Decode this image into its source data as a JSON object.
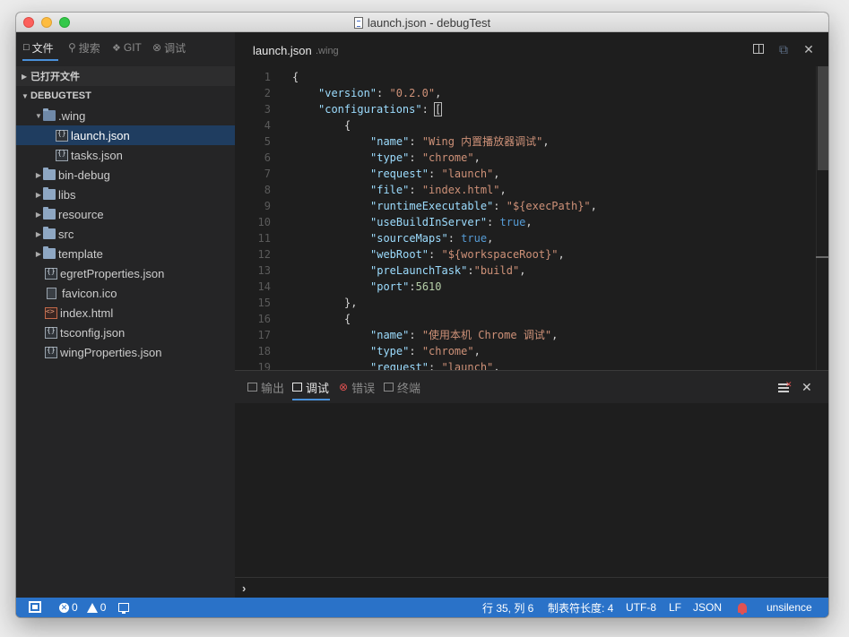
{
  "window": {
    "title": "launch.json - debugTest"
  },
  "sidebar": {
    "tabs": [
      {
        "label": "文件",
        "icon": "files-icon",
        "active": true
      },
      {
        "label": "搜索",
        "icon": "search-icon",
        "active": false
      },
      {
        "label": "GIT",
        "icon": "git-icon",
        "active": false
      },
      {
        "label": "调试",
        "icon": "debug-icon",
        "active": false
      }
    ],
    "sections": {
      "open_editors": "已打开文件",
      "project": "DEBUGTEST"
    },
    "tree": [
      {
        "label": ".wing",
        "type": "folder",
        "expanded": true,
        "depth": 1
      },
      {
        "label": "launch.json",
        "type": "json",
        "depth": 2,
        "selected": true
      },
      {
        "label": "tasks.json",
        "type": "json",
        "depth": 2
      },
      {
        "label": "bin-debug",
        "type": "folder",
        "depth": 1
      },
      {
        "label": "libs",
        "type": "folder",
        "depth": 1
      },
      {
        "label": "resource",
        "type": "folder",
        "depth": 1
      },
      {
        "label": "src",
        "type": "folder",
        "depth": 1
      },
      {
        "label": "template",
        "type": "folder",
        "depth": 1
      },
      {
        "label": "egretProperties.json",
        "type": "json",
        "depth": 1
      },
      {
        "label": "favicon.ico",
        "type": "ico",
        "depth": 1
      },
      {
        "label": "index.html",
        "type": "html",
        "depth": 1
      },
      {
        "label": "tsconfig.json",
        "type": "json",
        "depth": 1
      },
      {
        "label": "wingProperties.json",
        "type": "json",
        "depth": 1
      }
    ]
  },
  "editor": {
    "tab": {
      "file": "launch.json",
      "dir": ".wing"
    },
    "lines": [
      {
        "n": "1",
        "indent": 0,
        "parts": [
          {
            "t": "{",
            "c": "p"
          }
        ]
      },
      {
        "n": "2",
        "indent": 1,
        "parts": [
          {
            "t": "\"version\"",
            "c": "k"
          },
          {
            "t": ": ",
            "c": "p"
          },
          {
            "t": "\"0.2.0\"",
            "c": "s"
          },
          {
            "t": ",",
            "c": "p"
          }
        ]
      },
      {
        "n": "3",
        "indent": 1,
        "parts": [
          {
            "t": "\"configurations\"",
            "c": "k"
          },
          {
            "t": ": ",
            "c": "p"
          },
          {
            "t": "[",
            "c": "cur"
          }
        ]
      },
      {
        "n": "4",
        "indent": 2,
        "parts": [
          {
            "t": "{",
            "c": "p"
          }
        ]
      },
      {
        "n": "5",
        "indent": 3,
        "parts": [
          {
            "t": "\"name\"",
            "c": "k"
          },
          {
            "t": ": ",
            "c": "p"
          },
          {
            "t": "\"Wing 内置播放器调试\"",
            "c": "s"
          },
          {
            "t": ",",
            "c": "p"
          }
        ]
      },
      {
        "n": "6",
        "indent": 3,
        "parts": [
          {
            "t": "\"type\"",
            "c": "k"
          },
          {
            "t": ": ",
            "c": "p"
          },
          {
            "t": "\"chrome\"",
            "c": "s"
          },
          {
            "t": ",",
            "c": "p"
          }
        ]
      },
      {
        "n": "7",
        "indent": 3,
        "parts": [
          {
            "t": "\"request\"",
            "c": "k"
          },
          {
            "t": ": ",
            "c": "p"
          },
          {
            "t": "\"launch\"",
            "c": "s"
          },
          {
            "t": ",",
            "c": "p"
          }
        ]
      },
      {
        "n": "8",
        "indent": 3,
        "parts": [
          {
            "t": "\"file\"",
            "c": "k"
          },
          {
            "t": ": ",
            "c": "p"
          },
          {
            "t": "\"index.html\"",
            "c": "s"
          },
          {
            "t": ",",
            "c": "p"
          }
        ]
      },
      {
        "n": "9",
        "indent": 3,
        "parts": [
          {
            "t": "\"runtimeExecutable\"",
            "c": "k"
          },
          {
            "t": ": ",
            "c": "p"
          },
          {
            "t": "\"${execPath}\"",
            "c": "s"
          },
          {
            "t": ",",
            "c": "p"
          }
        ]
      },
      {
        "n": "10",
        "indent": 3,
        "parts": [
          {
            "t": "\"useBuildInServer\"",
            "c": "k"
          },
          {
            "t": ": ",
            "c": "p"
          },
          {
            "t": "true",
            "c": "b"
          },
          {
            "t": ",",
            "c": "p"
          }
        ]
      },
      {
        "n": "11",
        "indent": 3,
        "parts": [
          {
            "t": "\"sourceMaps\"",
            "c": "k"
          },
          {
            "t": ": ",
            "c": "p"
          },
          {
            "t": "true",
            "c": "b"
          },
          {
            "t": ",",
            "c": "p"
          }
        ]
      },
      {
        "n": "12",
        "indent": 3,
        "parts": [
          {
            "t": "\"webRoot\"",
            "c": "k"
          },
          {
            "t": ": ",
            "c": "p"
          },
          {
            "t": "\"${workspaceRoot}\"",
            "c": "s"
          },
          {
            "t": ",",
            "c": "p"
          }
        ]
      },
      {
        "n": "13",
        "indent": 3,
        "parts": [
          {
            "t": "\"preLaunchTask\"",
            "c": "k"
          },
          {
            "t": ":",
            "c": "p"
          },
          {
            "t": "\"build\"",
            "c": "s"
          },
          {
            "t": ",",
            "c": "p"
          }
        ]
      },
      {
        "n": "14",
        "indent": 3,
        "parts": [
          {
            "t": "\"port\"",
            "c": "k"
          },
          {
            "t": ":",
            "c": "p"
          },
          {
            "t": "5610",
            "c": "n"
          }
        ]
      },
      {
        "n": "15",
        "indent": 2,
        "parts": [
          {
            "t": "},",
            "c": "p"
          }
        ]
      },
      {
        "n": "16",
        "indent": 2,
        "parts": [
          {
            "t": "{",
            "c": "p"
          }
        ]
      },
      {
        "n": "17",
        "indent": 3,
        "parts": [
          {
            "t": "\"name\"",
            "c": "k"
          },
          {
            "t": ": ",
            "c": "p"
          },
          {
            "t": "\"使用本机 Chrome 调试\"",
            "c": "s"
          },
          {
            "t": ",",
            "c": "p"
          }
        ]
      },
      {
        "n": "18",
        "indent": 3,
        "parts": [
          {
            "t": "\"type\"",
            "c": "k"
          },
          {
            "t": ": ",
            "c": "p"
          },
          {
            "t": "\"chrome\"",
            "c": "s"
          },
          {
            "t": ",",
            "c": "p"
          }
        ]
      },
      {
        "n": "19",
        "indent": 3,
        "parts": [
          {
            "t": "\"request\"",
            "c": "k"
          },
          {
            "t": ": ",
            "c": "p"
          },
          {
            "t": "\"launch\"",
            "c": "s"
          },
          {
            "t": ",",
            "c": "p"
          }
        ]
      }
    ]
  },
  "panel": {
    "tabs": [
      {
        "label": "输出",
        "icon": "output-icon",
        "active": false
      },
      {
        "label": "调试",
        "icon": "debug-console-icon",
        "active": true
      },
      {
        "label": "错误",
        "icon": "error-icon",
        "active": false
      },
      {
        "label": "终端",
        "icon": "terminal-icon",
        "active": false
      }
    ],
    "prompt": "›"
  },
  "statusbar": {
    "errors": "0",
    "warnings": "0",
    "position": "行 35, 列 6",
    "tab_size": "制表符长度: 4",
    "encoding": "UTF-8",
    "eol": "LF",
    "language": "JSON",
    "user": "unsilence"
  },
  "colors": {
    "accent": "#2a72c8",
    "selection": "#1f3d60",
    "key": "#9cdcfe",
    "string": "#ce9178",
    "number": "#b5cea8",
    "boolean": "#569cd6"
  }
}
